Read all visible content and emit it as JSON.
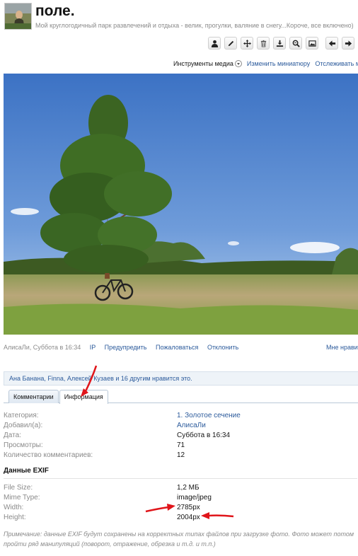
{
  "header": {
    "title": "поле.",
    "subtitle": "Мой круглогодичный парк развлечений и отдыха - велик, прогулки, валяние в снегу...Короче, все включено)"
  },
  "toolbar": {
    "icons": [
      "user-icon",
      "edit-icon",
      "move-icon",
      "trash-icon",
      "download-icon",
      "zoom-icon",
      "image-icon",
      "arrow-left-icon",
      "arrow-right-icon"
    ]
  },
  "links": {
    "media_tools": "Инструменты медиа",
    "change_thumb": "Изменить миниатюру",
    "follow": "Отслеживать медиа"
  },
  "meta": {
    "author_time": "АлисаЛи, Суббота в 16:34",
    "ip": "IP",
    "warn": "Предупредить",
    "report": "Пожаловаться",
    "reject": "Отклонить",
    "like": "Мне нравится"
  },
  "likes_text": "Ана Банана, Finna, Алексей Кузаев и 16 другим нравится это.",
  "tabs": [
    {
      "label": "Комментарии",
      "active": false
    },
    {
      "label": "Информация",
      "active": true
    }
  ],
  "info": {
    "category_k": "Категория:",
    "category_v": "1. Золотое сечение",
    "added_k": "Добавил(а):",
    "added_v": "АлисаЛи",
    "date_k": "Дата:",
    "date_v": "Суббота в 16:34",
    "views_k": "Просмотры:",
    "views_v": "71",
    "comments_k": "Количество комментариев:",
    "comments_v": "12"
  },
  "exif": {
    "heading": "Данные EXIF",
    "size_k": "File Size:",
    "size_v": "1,2 МБ",
    "mime_k": "Mime Type:",
    "mime_v": "image/jpeg",
    "width_k": "Width:",
    "width_v": "2785px",
    "height_k": "Height:",
    "height_v": "2004px"
  },
  "note": "Примечание: данные EXIF будут сохранены на корректных типах файлов при загрузке фото. Фото может потом пройти ряд манипуляций (поворот, отражение, обрезка и т.д. и т.п.)",
  "colors": {
    "link": "#2b5a9b",
    "annotation": "#e0151a"
  }
}
